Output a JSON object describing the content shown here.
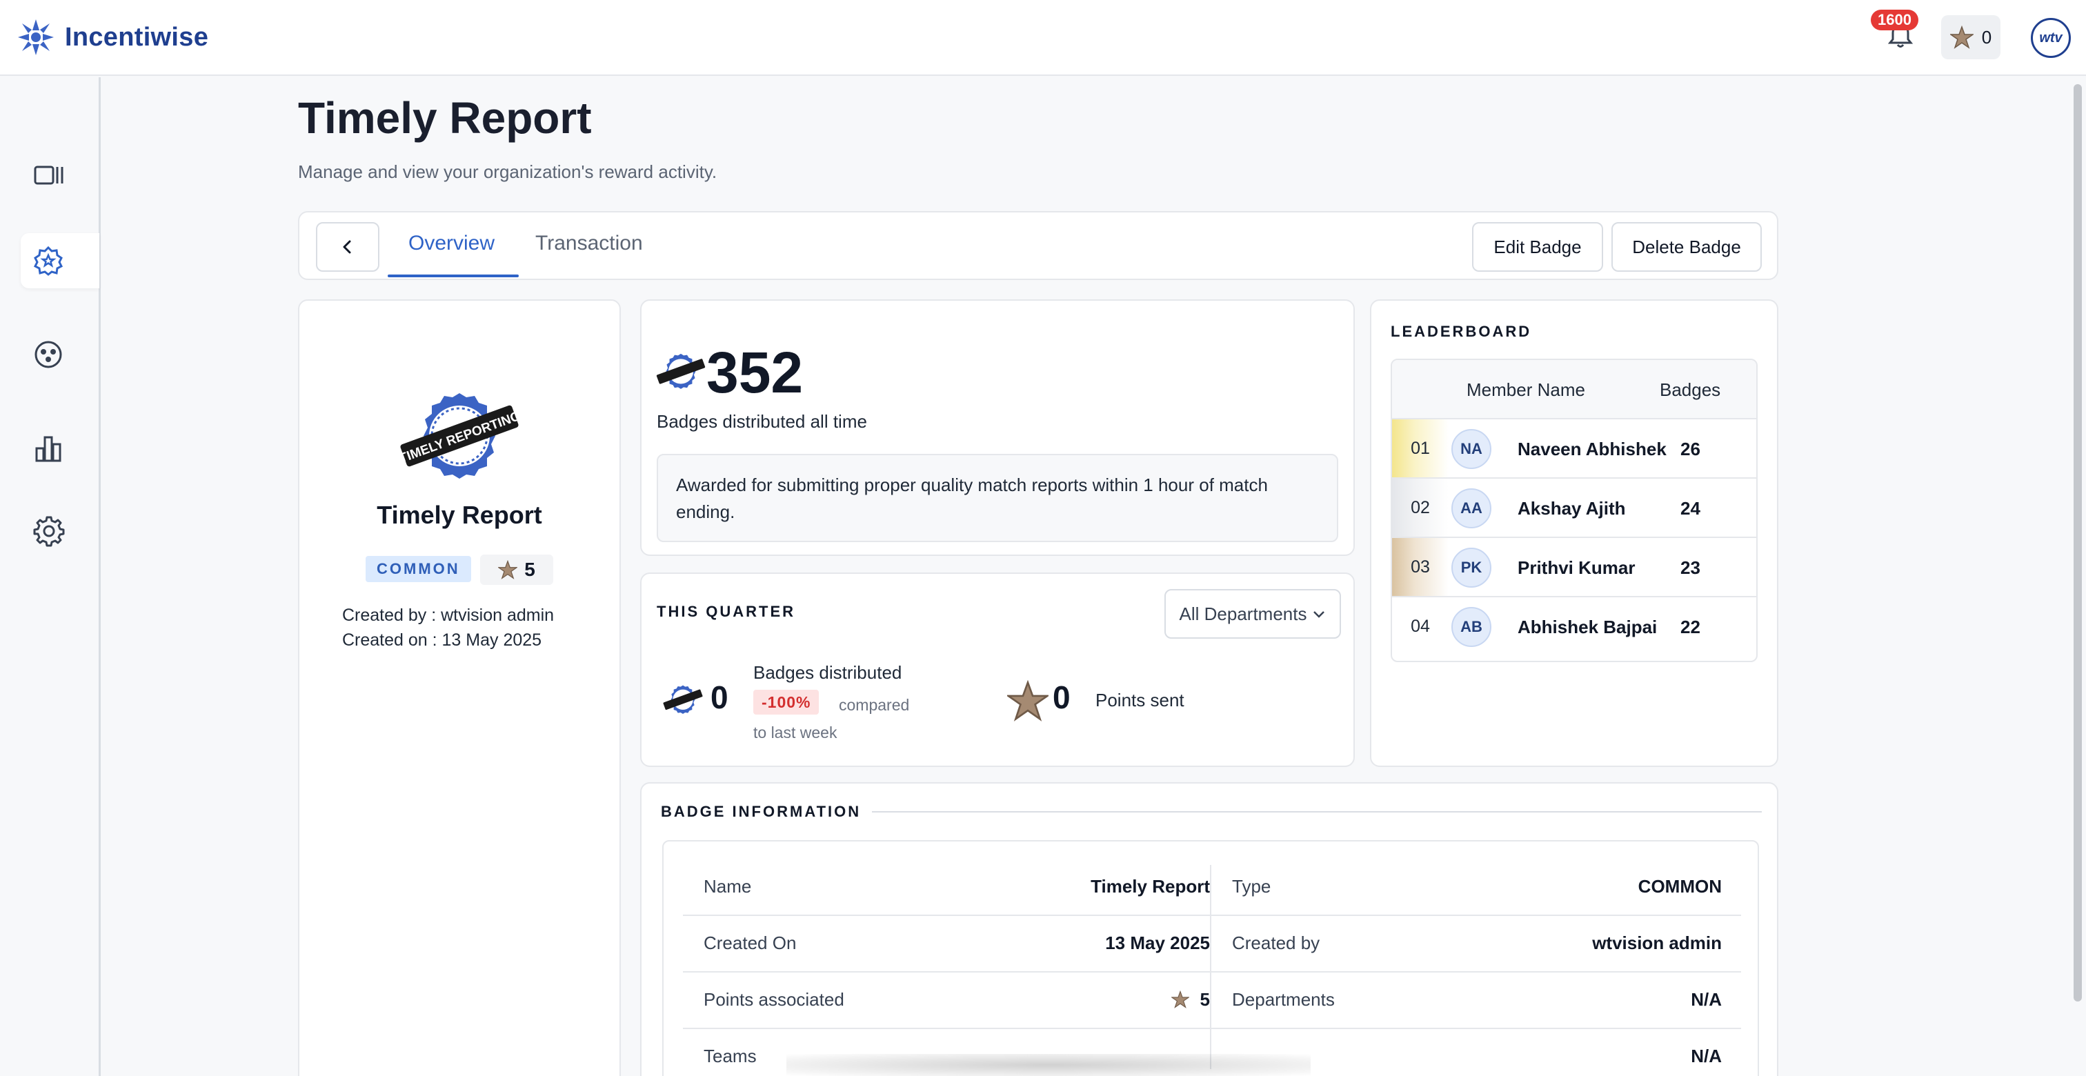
{
  "app": {
    "brand_name": "Incentiwise",
    "notification_count": "1600",
    "user_points": "0",
    "avatar_text": "wtv"
  },
  "colors": {
    "brand": "#1f3f8f",
    "accent": "#2f63c7",
    "danger": "#d32f2f",
    "badge_ribbon": "#1a1a1a",
    "badge_gear": "#3b63c4"
  },
  "sidebar": {
    "items": [
      {
        "icon": "panel-icon",
        "label": "Dashboard"
      },
      {
        "icon": "badge-gear-icon",
        "label": "Badges",
        "active": true
      },
      {
        "icon": "group-icon",
        "label": "Teams"
      },
      {
        "icon": "bar-chart-icon",
        "label": "Reports"
      },
      {
        "icon": "gear-icon",
        "label": "Settings"
      }
    ]
  },
  "page": {
    "title": "Timely Report",
    "subtitle": "Manage and view your organization's reward activity."
  },
  "tabs": {
    "items": [
      {
        "label": "Overview",
        "active": true
      },
      {
        "label": "Transaction",
        "active": false
      }
    ],
    "edit_label": "Edit Badge",
    "delete_label": "Delete Badge"
  },
  "badge": {
    "ribbon_text": "TIMELY REPORTING",
    "name": "Timely Report",
    "rarity": "COMMON",
    "points": "5",
    "created_by": "Created by : wtvision admin",
    "created_on": "Created on : 13 May 2025"
  },
  "stats": {
    "total": "352",
    "total_label": "Badges distributed all time",
    "description": "Awarded for submitting proper quality match reports within 1 hour of match ending."
  },
  "quarter": {
    "heading": "THIS QUARTER",
    "department_filter": "All Departments",
    "badges_count": "0",
    "badges_label": "Badges distributed",
    "change_pct": "-100%",
    "change_text": "compared to last week",
    "points_count": "0",
    "points_label": "Points sent"
  },
  "leaderboard": {
    "heading": "LEADERBOARD",
    "col_name": "Member Name",
    "col_badges": "Badges",
    "rows": [
      {
        "rank": "01",
        "initials": "NA",
        "name": "Naveen Abhishek",
        "badges": "26"
      },
      {
        "rank": "02",
        "initials": "AA",
        "name": "Akshay Ajith",
        "badges": "24"
      },
      {
        "rank": "03",
        "initials": "PK",
        "name": "Prithvi Kumar",
        "badges": "23"
      },
      {
        "rank": "04",
        "initials": "AB",
        "name": "Abhishek Bajpai",
        "badges": "22"
      }
    ]
  },
  "badge_info": {
    "heading": "BADGE INFORMATION",
    "rows": [
      {
        "k1": "Name",
        "v1": "Timely Report",
        "k2": "Type",
        "v2": "COMMON"
      },
      {
        "k1": "Created On",
        "v1": "13 May 2025",
        "k2": "Created by",
        "v2": "wtvision admin"
      },
      {
        "k1": "Points associated",
        "v1": "5",
        "k2": "Departments",
        "v2": "N/A"
      },
      {
        "k1": "Teams",
        "v1": "",
        "k2": "",
        "v2": "N/A"
      }
    ]
  }
}
